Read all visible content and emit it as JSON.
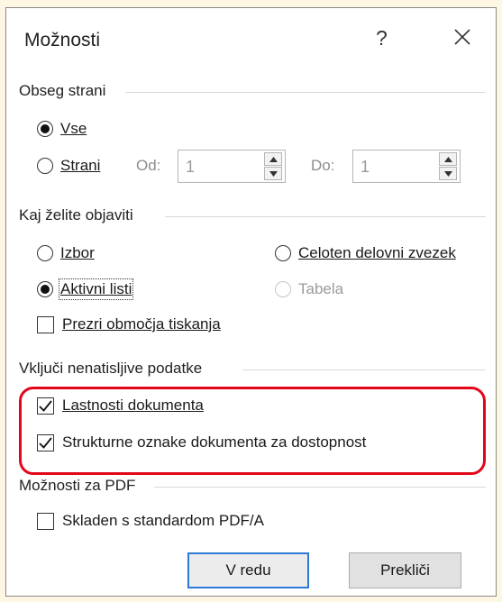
{
  "dialog": {
    "title": "Možnosti",
    "help_glyph": "?",
    "close_glyph": "✕"
  },
  "page_range": {
    "heading": "Obseg strani",
    "all_label": "Vse",
    "all_selected": true,
    "pages_label": "Strani",
    "from_label": "Od:",
    "from_value": "1",
    "to_label": "Do:",
    "to_value": "1"
  },
  "publish_what": {
    "heading": "Kaj želite objaviti",
    "selection_label": "Izbor",
    "entire_workbook_label": "Celoten delovni zvezek",
    "active_sheets_label": "Aktivni listi",
    "active_sheets_selected": true,
    "table_label": "Tabela",
    "table_disabled": true,
    "ignore_print_areas_label": "Prezri območja tiskanja",
    "ignore_print_areas_checked": false
  },
  "non_printing": {
    "heading": "Vključi nenatisljive podatke",
    "doc_properties_label": "Lastnosti dokumenta",
    "doc_properties_checked": true,
    "structure_tags_label": "Strukturne oznake dokumenta za dostopnost",
    "structure_tags_checked": true,
    "highlight_color": "#e3061b"
  },
  "pdf_options": {
    "heading": "Možnosti za PDF",
    "pdfa_label": "Skladen s standardom PDF/A",
    "pdfa_checked": false
  },
  "buttons": {
    "ok_label": "V redu",
    "cancel_label": "Prekliči"
  },
  "colors": {
    "page_background": "#fdf6e3",
    "primary_button_border": "#2f79d6"
  }
}
